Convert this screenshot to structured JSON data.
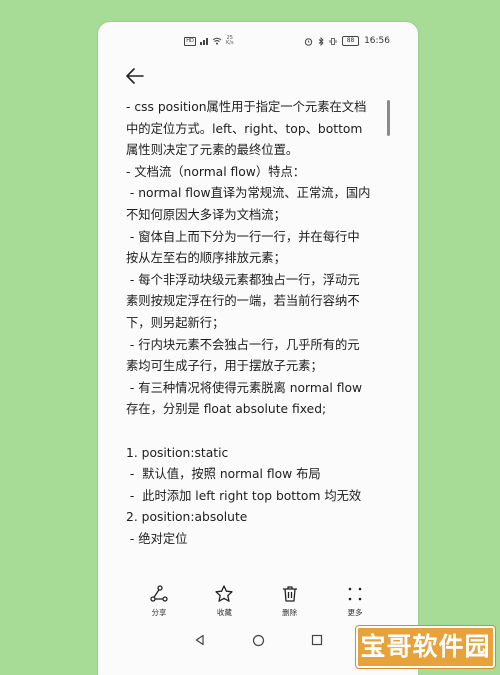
{
  "status_bar": {
    "network_speed": "25\nK/s",
    "battery": "88",
    "time": "16:56"
  },
  "content_lines": [
    "- css position属性用于指定一个元素在文档",
    "中的定位方式。left、right、top、bottom",
    "属性则决定了元素的最终位置。",
    "- 文档流（normal flow）特点：",
    " - normal flow直译为常规流、正常流，国内",
    "不知何原因大多译为文档流；",
    " - 窗体自上而下分为一行一行，并在每行中",
    "按从左至右的顺序排放元素；",
    " - 每个非浮动块级元素都独占一行，浮动元",
    "素则按规定浮在行的一端，若当前行容纳不",
    "下，则另起新行；",
    " - 行内块元素不会独占一行，几乎所有的元",
    "素均可生成子行，用于摆放子元素；",
    " - 有三种情况将使得元素脱离 normal flow",
    "存在，分别是 float absolute fixed;",
    "",
    "1. position:static",
    " -  默认值，按照 normal flow 布局",
    " -  此时添加 left right top bottom 均无效",
    "2. position:absolute",
    " - 绝对定位"
  ],
  "toolbar": {
    "share": "分享",
    "favorite": "收藏",
    "delete": "删除",
    "more": "更多"
  },
  "watermark": "宝哥软件园"
}
